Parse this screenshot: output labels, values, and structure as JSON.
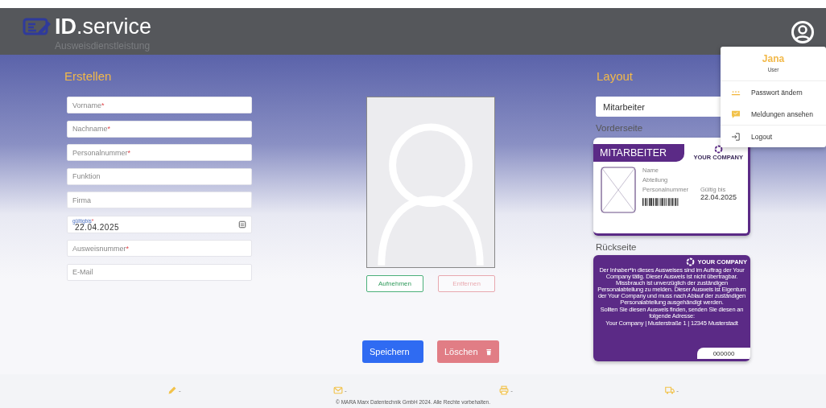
{
  "header": {
    "logo": "**ID**.service",
    "subtitle": "Ausweisdienstleistung"
  },
  "create": {
    "title": "Erstellen",
    "fields": [
      {
        "kind": "text",
        "placeholder": "Vorname",
        "mark": "*"
      },
      {
        "kind": "text",
        "placeholder": "Nachname",
        "mark": "*"
      },
      {
        "kind": "text",
        "placeholder": "Personalnummer",
        "mark": "*"
      },
      {
        "kind": "text",
        "placeholder": "Funktion"
      },
      {
        "kind": "text",
        "placeholder": "Firma"
      },
      {
        "kind": "date",
        "label": "gültigbis",
        "mark": "*",
        "value": "22.04.2025"
      },
      {
        "kind": "text",
        "placeholder": "Ausweisnummer",
        "mark": "*"
      },
      {
        "kind": "text",
        "placeholder": "E-Mail"
      }
    ]
  },
  "photo": {
    "buttons": [
      {
        "label": "Aufnehmen",
        "kind": "ok",
        "disabled": false
      },
      {
        "label": "Entfernen",
        "kind": "danger",
        "disabled": true
      }
    ]
  },
  "actions": [
    {
      "label": "Speichern",
      "kind": "save",
      "disabled": false
    },
    {
      "label": "Löschen",
      "kind": "delete",
      "disabled": true
    }
  ],
  "layout": {
    "title": "Layout",
    "select": "Mitarbeiter",
    "front_title": "Vorderseite",
    "back_title": "Rückseite",
    "front": {
      "role": "MITARBEITER",
      "company": "YOUR COMPANY",
      "labels": [
        "Name",
        "Abteilung",
        "Personalnummer"
      ],
      "valid_label": "Gültig bis",
      "valid_date": "22.04.2025"
    },
    "back": {
      "company": "YOUR COMPANY",
      "text": "Der Inhaber*in dieses Ausweises sind im Auftrag der Your Company tätig. Dieser Ausweis ist nicht übertragbar. Missbrauch ist unverzüglich der zuständigen Personalabteilung zu melden. Dieser Ausweis ist Eigentum der Your Company und muss nach Ablauf der zuständigen Personalabteilung ausgehändigt werden.",
      "found": "Sollten Sie diesen Ausweis finden, senden Sie diesen an folgende Adresse:",
      "address": "Your Company | Musterstraße 1 | 12345 Musterstadt",
      "number": "000000"
    }
  },
  "user_menu": {
    "name": "Jana",
    "role": "User",
    "items": [
      {
        "kind": "key",
        "label": "Passwort ändern"
      },
      {
        "kind": "messages",
        "label": "Meldungen ansehen"
      },
      {
        "kind": "logout",
        "label": "Logout"
      }
    ]
  },
  "footer": {
    "stats": [
      {
        "kind": "pencil",
        "value": "-"
      },
      {
        "kind": "mail",
        "value": "-"
      },
      {
        "kind": "printer",
        "value": "-"
      },
      {
        "kind": "truck",
        "value": "-"
      }
    ],
    "copyright": "© MARA Marx Datentechnik GmbH 2024. Alle Rechte vorbehalten."
  }
}
